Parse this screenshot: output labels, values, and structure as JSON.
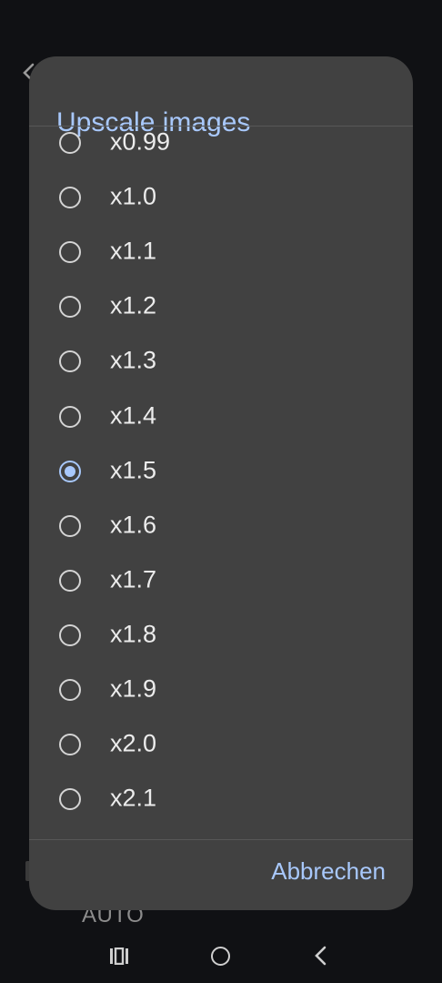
{
  "background": {
    "bottom_label": "AUTO"
  },
  "dialog": {
    "title": "Upscale images",
    "options": [
      {
        "label": "x0.99",
        "selected": false
      },
      {
        "label": "x1.0",
        "selected": false
      },
      {
        "label": "x1.1",
        "selected": false
      },
      {
        "label": "x1.2",
        "selected": false
      },
      {
        "label": "x1.3",
        "selected": false
      },
      {
        "label": "x1.4",
        "selected": false
      },
      {
        "label": "x1.5",
        "selected": true
      },
      {
        "label": "x1.6",
        "selected": false
      },
      {
        "label": "x1.7",
        "selected": false
      },
      {
        "label": "x1.8",
        "selected": false
      },
      {
        "label": "x1.9",
        "selected": false
      },
      {
        "label": "x2.0",
        "selected": false
      },
      {
        "label": "x2.1",
        "selected": false
      }
    ],
    "cancel_label": "Abbrechen"
  },
  "colors": {
    "accent": "#a8c8fb",
    "dialog_bg": "#414141",
    "screen_bg": "#101114"
  }
}
